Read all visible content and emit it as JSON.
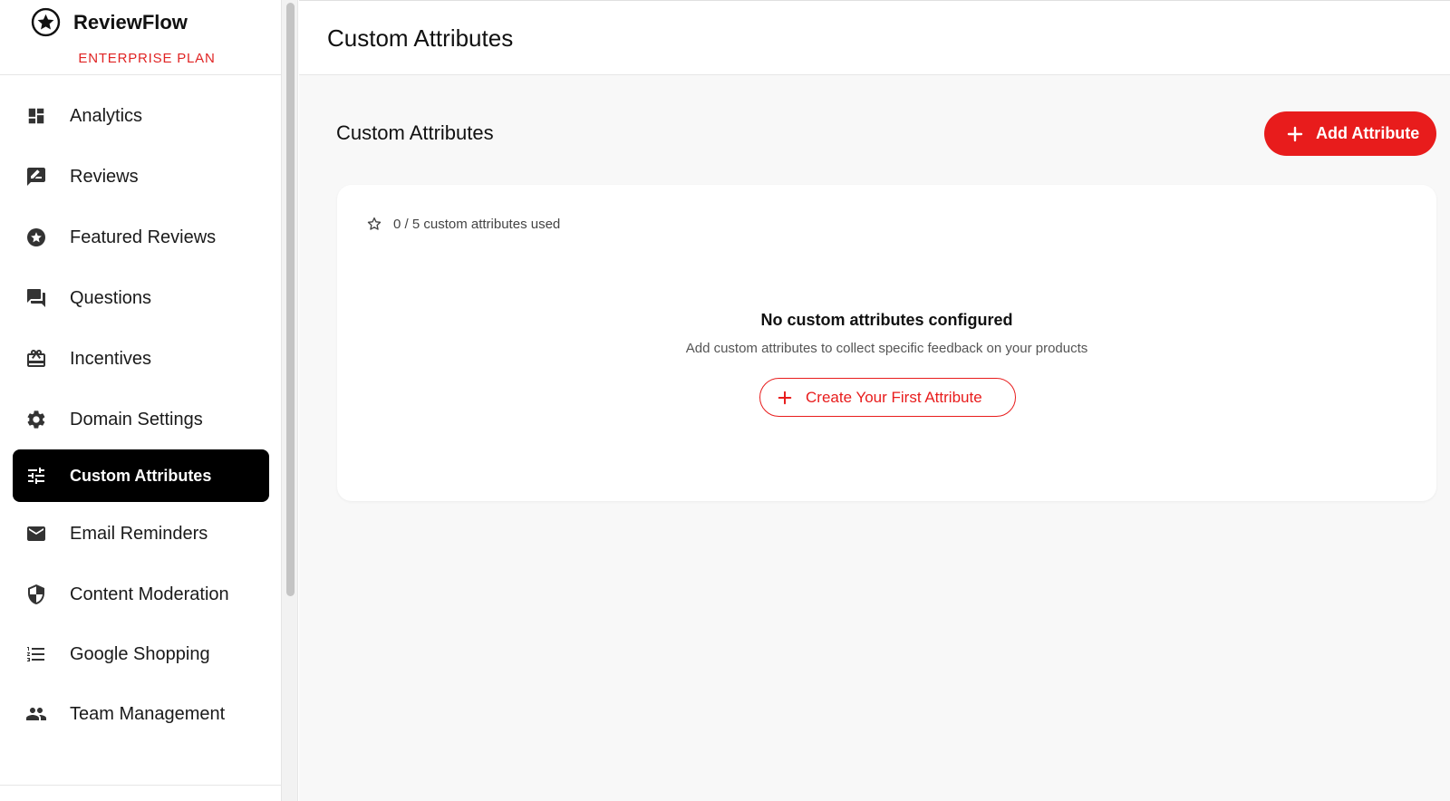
{
  "brand": {
    "name": "ReviewFlow",
    "plan": "ENTERPRISE PLAN",
    "logo_icon": "star-circle-icon"
  },
  "sidebar": {
    "items": [
      {
        "label": "Analytics",
        "icon": "dashboard-icon",
        "active": false
      },
      {
        "label": "Reviews",
        "icon": "rate-review-icon",
        "active": false
      },
      {
        "label": "Featured Reviews",
        "icon": "star-badge-icon",
        "active": false
      },
      {
        "label": "Questions",
        "icon": "forum-icon",
        "active": false
      },
      {
        "label": "Incentives",
        "icon": "gift-card-icon",
        "active": false
      },
      {
        "label": "Domain Settings",
        "icon": "gear-icon",
        "active": false
      },
      {
        "label": "Custom Attributes",
        "icon": "tune-icon",
        "active": true
      },
      {
        "label": "Email Reminders",
        "icon": "mail-icon",
        "active": false
      },
      {
        "label": "Content Moderation",
        "icon": "shield-icon",
        "active": false
      },
      {
        "label": "Google Shopping",
        "icon": "list-icon",
        "active": false
      },
      {
        "label": "Team Management",
        "icon": "people-icon",
        "active": false
      }
    ]
  },
  "header": {
    "title": "Custom Attributes"
  },
  "section": {
    "title": "Custom Attributes",
    "add_button_label": "Add Attribute"
  },
  "usage": {
    "text": "0 / 5 custom attributes used",
    "used": 0,
    "limit": 5
  },
  "empty_state": {
    "title": "No custom attributes configured",
    "description": "Add custom attributes to collect specific feedback on your products",
    "button_label": "Create Your First Attribute"
  },
  "colors": {
    "accent": "#e81c1c",
    "active_nav_bg": "#000000",
    "main_bg": "#f8f8f8"
  }
}
